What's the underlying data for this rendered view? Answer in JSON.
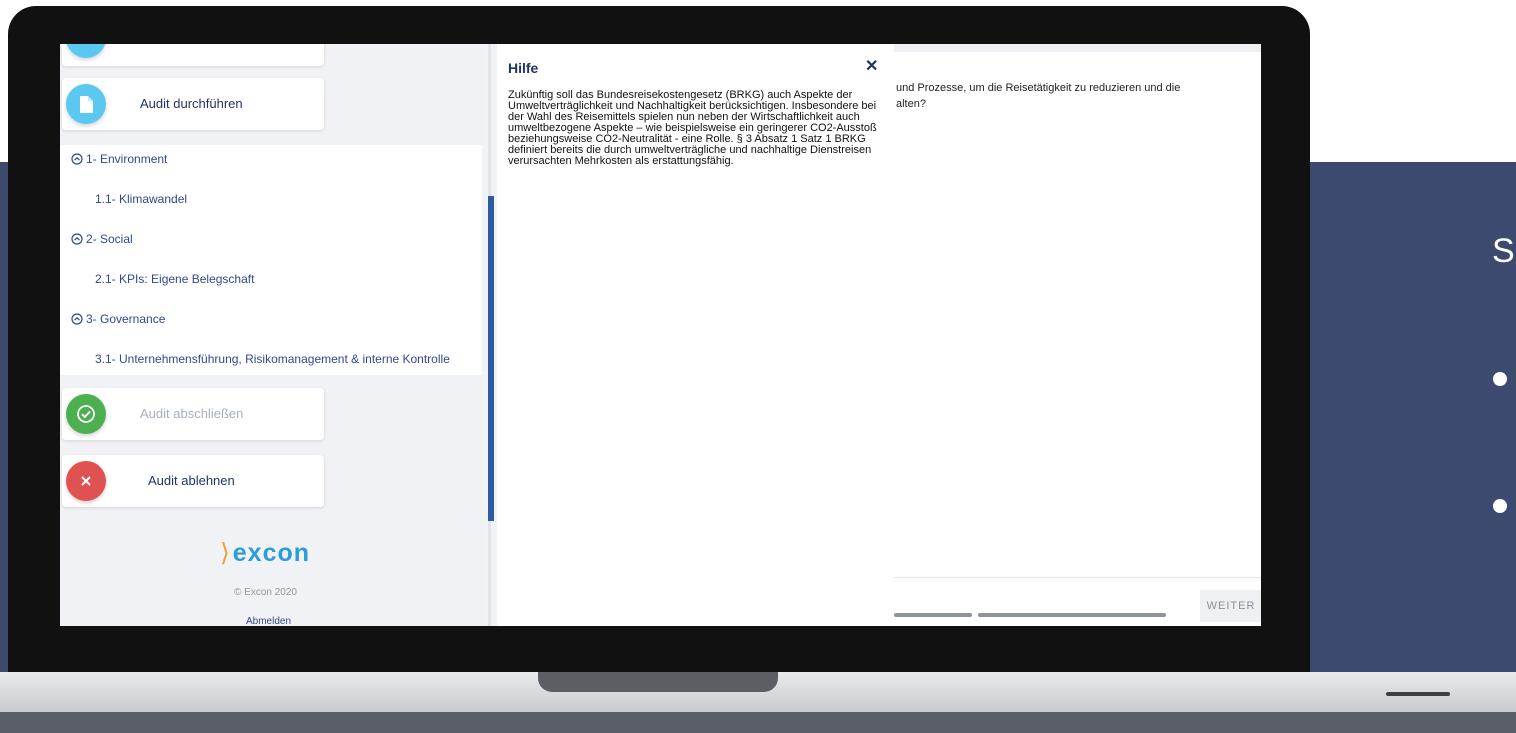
{
  "slide": {
    "letter": "S",
    "colors": {
      "band": "#3d4a70"
    }
  },
  "sidebar": {
    "cards": {
      "audit_durchfuehren": "Audit durchführen",
      "audit_abschliessen": "Audit abschließen",
      "audit_ablehnen": "Audit ablehnen"
    },
    "tree": {
      "sections": [
        {
          "label": "1- Environment",
          "items": [
            "1.1- Klimawandel"
          ]
        },
        {
          "label": "2- Social",
          "items": [
            "2.1- KPIs: Eigene Belegschaft"
          ]
        },
        {
          "label": "3- Governance",
          "items": [
            "3.1- Unternehmensführung, Risikomanagement & interne Kontrolle"
          ]
        }
      ]
    },
    "logo_text": "excon",
    "copyright": "© Excon 2020",
    "logout": "Abmelden"
  },
  "help": {
    "title": "Hilfe",
    "close_icon": "close-icon",
    "text": "Zukünftig soll das Bundesreisekostengesetz (BRKG) auch Aspekte der Umweltverträglichkeit und Nachhaltigkeit berücksichtigen. Insbesondere bei der Wahl des Reisemittels spielen nun neben der Wirtschaftlichkeit auch umweltbezogene Aspekte – wie beispielsweise ein geringerer CO2-Ausstoß beziehungsweise CO2-Neutralität - eine Rolle. § 3 Absatz 1 Satz 1 BRKG definiert bereits die durch umweltverträgliche und nachhaltige Dienstreisen verursachten Mehrkosten als erstattungsfähig."
  },
  "main": {
    "question_line1": "und Prozesse, um die Reisetätigkeit zu reduzieren und die",
    "question_line2": "alten?",
    "next_button": "WEITER"
  },
  "colors": {
    "accent": "#2e5aa6",
    "card_icon_doc": "#5ac8f0",
    "card_icon_check": "#4caf50",
    "card_icon_cross": "#e05252"
  }
}
